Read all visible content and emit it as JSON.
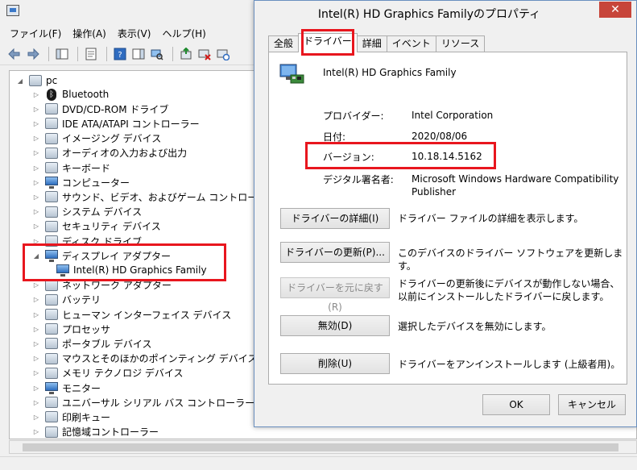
{
  "devmgr": {
    "menu": [
      "ファイル(F)",
      "操作(A)",
      "表示(V)",
      "ヘルプ(H)"
    ],
    "root": "pc",
    "tree": [
      {
        "label": "Bluetooth",
        "icon": "bluetooth-icon"
      },
      {
        "label": "DVD/CD-ROM ドライブ",
        "icon": "optical-drive-icon"
      },
      {
        "label": "IDE ATA/ATAPI コントローラー",
        "icon": "ide-controller-icon"
      },
      {
        "label": "イメージング デバイス",
        "icon": "camera-icon"
      },
      {
        "label": "オーディオの入力および出力",
        "icon": "speaker-icon"
      },
      {
        "label": "キーボード",
        "icon": "keyboard-icon"
      },
      {
        "label": "コンピューター",
        "icon": "computer-icon"
      },
      {
        "label": "サウンド、ビデオ、およびゲーム コントローラー",
        "icon": "sound-icon"
      },
      {
        "label": "システム デバイス",
        "icon": "system-device-icon"
      },
      {
        "label": "セキュリティ デバイス",
        "icon": "security-device-icon"
      },
      {
        "label": "ディスク ドライブ",
        "icon": "disk-drive-icon"
      },
      {
        "label": "ディスプレイ アダプター",
        "icon": "display-adapter-icon"
      },
      {
        "label": "Intel(R) HD Graphics Family",
        "icon": "display-adapter-icon"
      },
      {
        "label": "ネットワーク アダプター",
        "icon": "network-adapter-icon"
      },
      {
        "label": "バッテリ",
        "icon": "battery-icon"
      },
      {
        "label": "ヒューマン インターフェイス デバイス",
        "icon": "hid-icon"
      },
      {
        "label": "プロセッサ",
        "icon": "processor-icon"
      },
      {
        "label": "ポータブル デバイス",
        "icon": "portable-device-icon"
      },
      {
        "label": "マウスとそのほかのポインティング デバイス",
        "icon": "mouse-icon"
      },
      {
        "label": "メモリ テクノロジ デバイス",
        "icon": "memory-icon"
      },
      {
        "label": "モニター",
        "icon": "monitor-icon"
      },
      {
        "label": "ユニバーサル シリアル バス コントローラー",
        "icon": "usb-icon"
      },
      {
        "label": "印刷キュー",
        "icon": "printer-icon"
      },
      {
        "label": "記憶域コントローラー",
        "icon": "storage-controller-icon"
      }
    ]
  },
  "dialog": {
    "title": "Intel(R) HD Graphics Familyのプロパティ",
    "tabs": [
      "全般",
      "ドライバー",
      "詳細",
      "イベント",
      "リソース"
    ],
    "active_tab": "ドライバー",
    "device_name": "Intel(R) HD Graphics Family",
    "props": {
      "provider_label": "プロバイダー:",
      "provider_value": "Intel Corporation",
      "date_label": "日付:",
      "date_value": "2020/08/06",
      "version_label": "バージョン:",
      "version_value": "10.18.14.5162",
      "signer_label": "デジタル署名者:",
      "signer_value": "Microsoft Windows Hardware Compatibility Publisher"
    },
    "actions": [
      {
        "label": "ドライバーの詳細(I)",
        "desc": "ドライバー ファイルの詳細を表示します。",
        "enabled": true
      },
      {
        "label": "ドライバーの更新(P)...",
        "desc": "このデバイスのドライバー ソフトウェアを更新します。",
        "enabled": true
      },
      {
        "label": "ドライバーを元に戻す(R)",
        "desc": "ドライバーの更新後にデバイスが動作しない場合、以前にインストールしたドライバーに戻します。",
        "enabled": false
      },
      {
        "label": "無効(D)",
        "desc": "選択したデバイスを無効にします。",
        "enabled": true
      },
      {
        "label": "削除(U)",
        "desc": "ドライバーをアンインストールします (上級者用)。",
        "enabled": true
      }
    ],
    "ok_label": "OK",
    "cancel_label": "キャンセル",
    "close_glyph": "✕"
  },
  "colors": {
    "highlight": "#e8161e",
    "close_button": "#c7453a"
  }
}
